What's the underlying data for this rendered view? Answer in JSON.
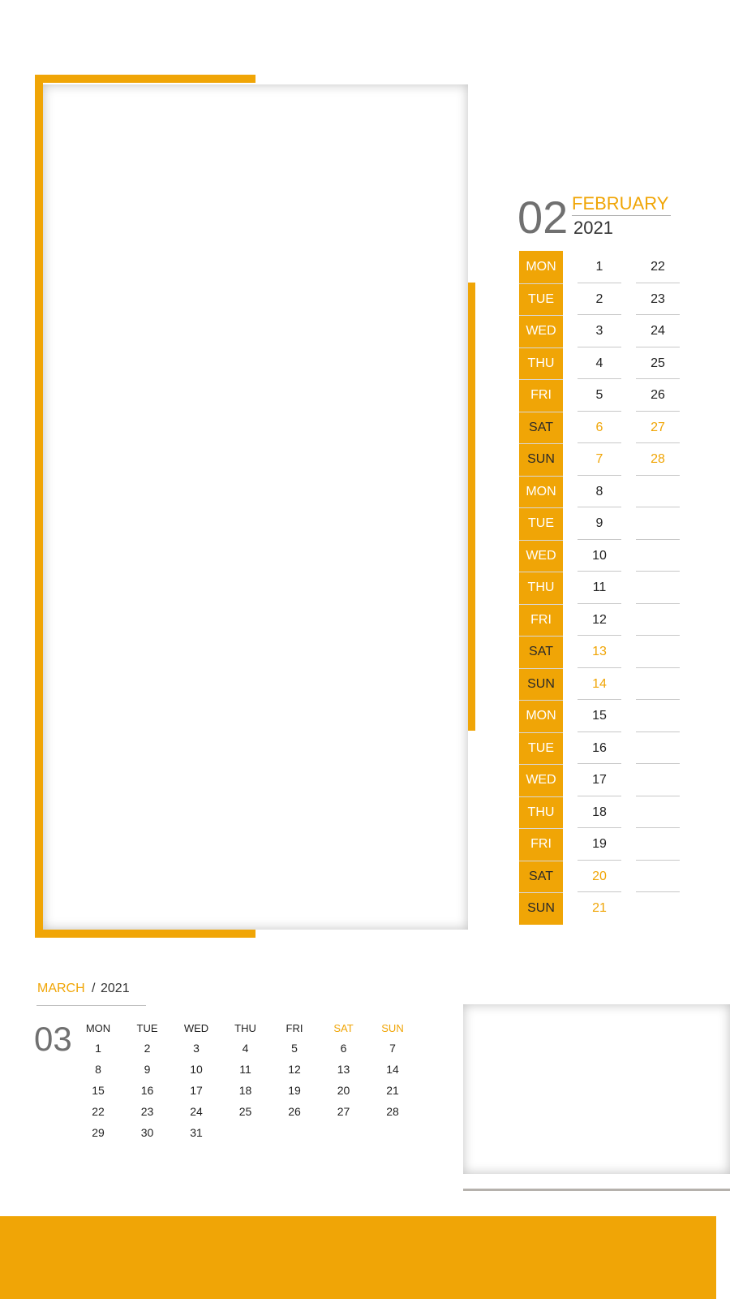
{
  "february": {
    "number": "02",
    "month": "FEBRUARY",
    "year": "2021",
    "days": [
      {
        "day": "MON",
        "weekend": false,
        "date1": "1",
        "date2": "22"
      },
      {
        "day": "TUE",
        "weekend": false,
        "date1": "2",
        "date2": "23"
      },
      {
        "day": "WED",
        "weekend": false,
        "date1": "3",
        "date2": "24"
      },
      {
        "day": "THU",
        "weekend": false,
        "date1": "4",
        "date2": "25"
      },
      {
        "day": "FRI",
        "weekend": false,
        "date1": "5",
        "date2": "26"
      },
      {
        "day": "SAT",
        "weekend": true,
        "date1": "6",
        "date2": "27"
      },
      {
        "day": "SUN",
        "weekend": true,
        "date1": "7",
        "date2": "28"
      },
      {
        "day": "MON",
        "weekend": false,
        "date1": "8",
        "date2": ""
      },
      {
        "day": "TUE",
        "weekend": false,
        "date1": "9",
        "date2": ""
      },
      {
        "day": "WED",
        "weekend": false,
        "date1": "10",
        "date2": ""
      },
      {
        "day": "THU",
        "weekend": false,
        "date1": "11",
        "date2": ""
      },
      {
        "day": "FRI",
        "weekend": false,
        "date1": "12",
        "date2": ""
      },
      {
        "day": "SAT",
        "weekend": true,
        "date1": "13",
        "date2": ""
      },
      {
        "day": "SUN",
        "weekend": true,
        "date1": "14",
        "date2": ""
      },
      {
        "day": "MON",
        "weekend": false,
        "date1": "15",
        "date2": ""
      },
      {
        "day": "TUE",
        "weekend": false,
        "date1": "16",
        "date2": ""
      },
      {
        "day": "WED",
        "weekend": false,
        "date1": "17",
        "date2": ""
      },
      {
        "day": "THU",
        "weekend": false,
        "date1": "18",
        "date2": ""
      },
      {
        "day": "FRI",
        "weekend": false,
        "date1": "19",
        "date2": ""
      },
      {
        "day": "SAT",
        "weekend": true,
        "date1": "20",
        "date2": ""
      },
      {
        "day": "SUN",
        "weekend": true,
        "date1": "21",
        "date2": ""
      }
    ]
  },
  "march": {
    "month": "MARCH",
    "separator": "/",
    "year": "2021",
    "number": "03",
    "headers": [
      {
        "label": "MON",
        "weekend": false
      },
      {
        "label": "TUE",
        "weekend": false
      },
      {
        "label": "WED",
        "weekend": false
      },
      {
        "label": "THU",
        "weekend": false
      },
      {
        "label": "FRI",
        "weekend": false
      },
      {
        "label": "SAT",
        "weekend": true
      },
      {
        "label": "SUN",
        "weekend": true
      }
    ],
    "weeks": [
      [
        "1",
        "2",
        "3",
        "4",
        "5",
        "6",
        "7"
      ],
      [
        "8",
        "9",
        "10",
        "11",
        "12",
        "13",
        "14"
      ],
      [
        "15",
        "16",
        "17",
        "18",
        "19",
        "20",
        "21"
      ],
      [
        "22",
        "23",
        "24",
        "25",
        "26",
        "27",
        "28"
      ],
      [
        "29",
        "30",
        "31",
        "",
        "",
        "",
        ""
      ]
    ]
  },
  "colors": {
    "accent": "#f0a506",
    "number_gray": "#707070",
    "text": "#222222",
    "divider": "#c8c8c8"
  }
}
